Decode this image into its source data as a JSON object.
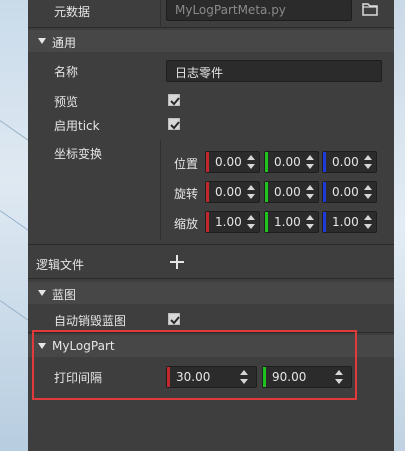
{
  "top": {
    "label": "元数据",
    "file_value": "MyLogPartMeta.py",
    "folder_icon": "folder-icon"
  },
  "general": {
    "title": "通用",
    "name_label": "名称",
    "name_value": "日志零件",
    "preview_label": "预览",
    "enable_tick_label": "启用tick",
    "transform_label": "坐标变换",
    "position_label": "位置",
    "rotation_label": "旋转",
    "scale_label": "缩放",
    "position": [
      "0.00",
      "0.00",
      "0.00"
    ],
    "rotation": [
      "0.00",
      "0.00",
      "0.00"
    ],
    "scale": [
      "1.00",
      "1.00",
      "1.00"
    ],
    "preview_checked": true,
    "enable_tick_checked": true
  },
  "logic": {
    "label": "逻辑文件",
    "add_icon": "plus-icon"
  },
  "blueprint": {
    "title": "蓝图",
    "auto_destroy_label": "自动销毁蓝图",
    "auto_destroy_checked": true
  },
  "mylogpart": {
    "title": "MyLogPart",
    "interval_label": "打印间隔",
    "values": [
      "30.00",
      "90.00"
    ]
  },
  "colors": {
    "x_axis": "#c0282d",
    "y_axis": "#1ec31e",
    "z_axis": "#1f3ad6",
    "highlight": "#e03a3a"
  }
}
